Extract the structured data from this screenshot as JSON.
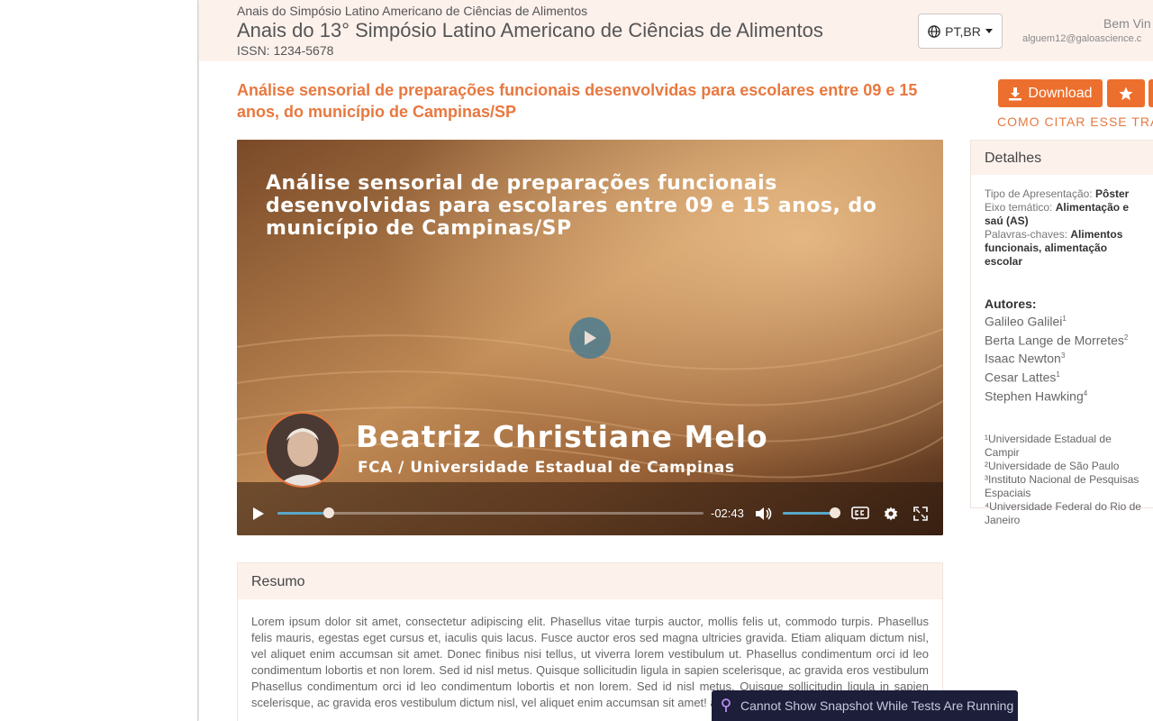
{
  "header": {
    "event_small": "Anais do Simpósio Latino Americano de Ciências de Alimentos",
    "event_title": "Anais do 13° Simpósio Latino Americano de Ciências de Alimentos",
    "issn": "ISSN: 1234-5678",
    "language": "PT,BR",
    "user_greeting": "Bem Vin",
    "user_email": "alguem12@galoascience.c"
  },
  "paper": {
    "title": "Análise sensorial de preparações funcionais desenvolvidas para escolares entre 09 e 15 anos, do município de Campinas/SP",
    "download_label": "Download",
    "cite_label": "COMO CITAR ESSE TRABA"
  },
  "video": {
    "title": "Análise sensorial de preparações funcionais desenvolvidas para escolares entre 09 e 15 anos, do município de Campinas/SP",
    "speaker_name": "Beatriz Christiane Melo",
    "speaker_institution": "FCA / Universidade Estadual de Campinas",
    "time_remaining": "-02:43",
    "progress": 0.12,
    "volume": 0.9
  },
  "details": {
    "heading": "Detalhes",
    "presentation_label": "Tipo de Apresentação:",
    "presentation_value": "Pôster",
    "axis_label": "Eixo temático:",
    "axis_value": "Alimentação e saú (AS)",
    "keywords_label": "Palavras-chaves:",
    "keywords_value": "Alimentos funcionais, alimentação escolar",
    "authors_label": "Autores:",
    "authors": [
      {
        "name": "Galileo Galilei",
        "sup": "1"
      },
      {
        "name": "Berta Lange de Morretes",
        "sup": "2"
      },
      {
        "name": "Isaac Newton",
        "sup": "3"
      },
      {
        "name": "Cesar Lattes",
        "sup": "1"
      },
      {
        "name": "Stephen Hawking",
        "sup": "4"
      }
    ],
    "affiliations": [
      "¹Universidade Estadual de Campir",
      "²Universidade de São Paulo",
      "³Instituto Nacional de Pesquisas Espaciais",
      "⁴Universidade Federal do Rio de Janeiro"
    ]
  },
  "resumo": {
    "heading": "Resumo",
    "text": "Lorem ipsum dolor sit amet, consectetur adipiscing elit. Phasellus vitae turpis auctor, mollis felis ut, commodo turpis. Phasellus felis mauris, egestas eget cursus et, iaculis quis lacus. Fusce auctor eros sed magna ultricies gravida. Etiam aliquam dictum nisl, vel aliquet enim accumsan sit amet. Donec finibus nisi tellus, ut viverra lorem vestibulum ut. Phasellus condimentum orci id leo condimentum lobortis et non lorem. Sed id nisl metus. Quisque sollicitudin ligula in sapien scelerisque, ac gravida eros vestibulum Phasellus condimentum orci id leo condimentum lobortis et non lorem. Sed id nisl metus. Quisque sollicitudin ligula in sapien scelerisque, ac gravida eros vestibulum dictum nisl, vel aliquet enim accumsan sit amet! accumsant."
  },
  "toast": {
    "message": "Cannot Show Snapshot While Tests Are Running"
  },
  "colors": {
    "accent": "#ec6f2d",
    "header_bg": "#fdf1ec",
    "toast_bg": "#1c1e3a"
  },
  "icons": [
    "globe-icon",
    "caret-down-icon",
    "download-icon",
    "star-icon",
    "play-icon",
    "volume-icon",
    "captions-icon",
    "gear-icon",
    "fullscreen-icon",
    "pin-icon"
  ]
}
